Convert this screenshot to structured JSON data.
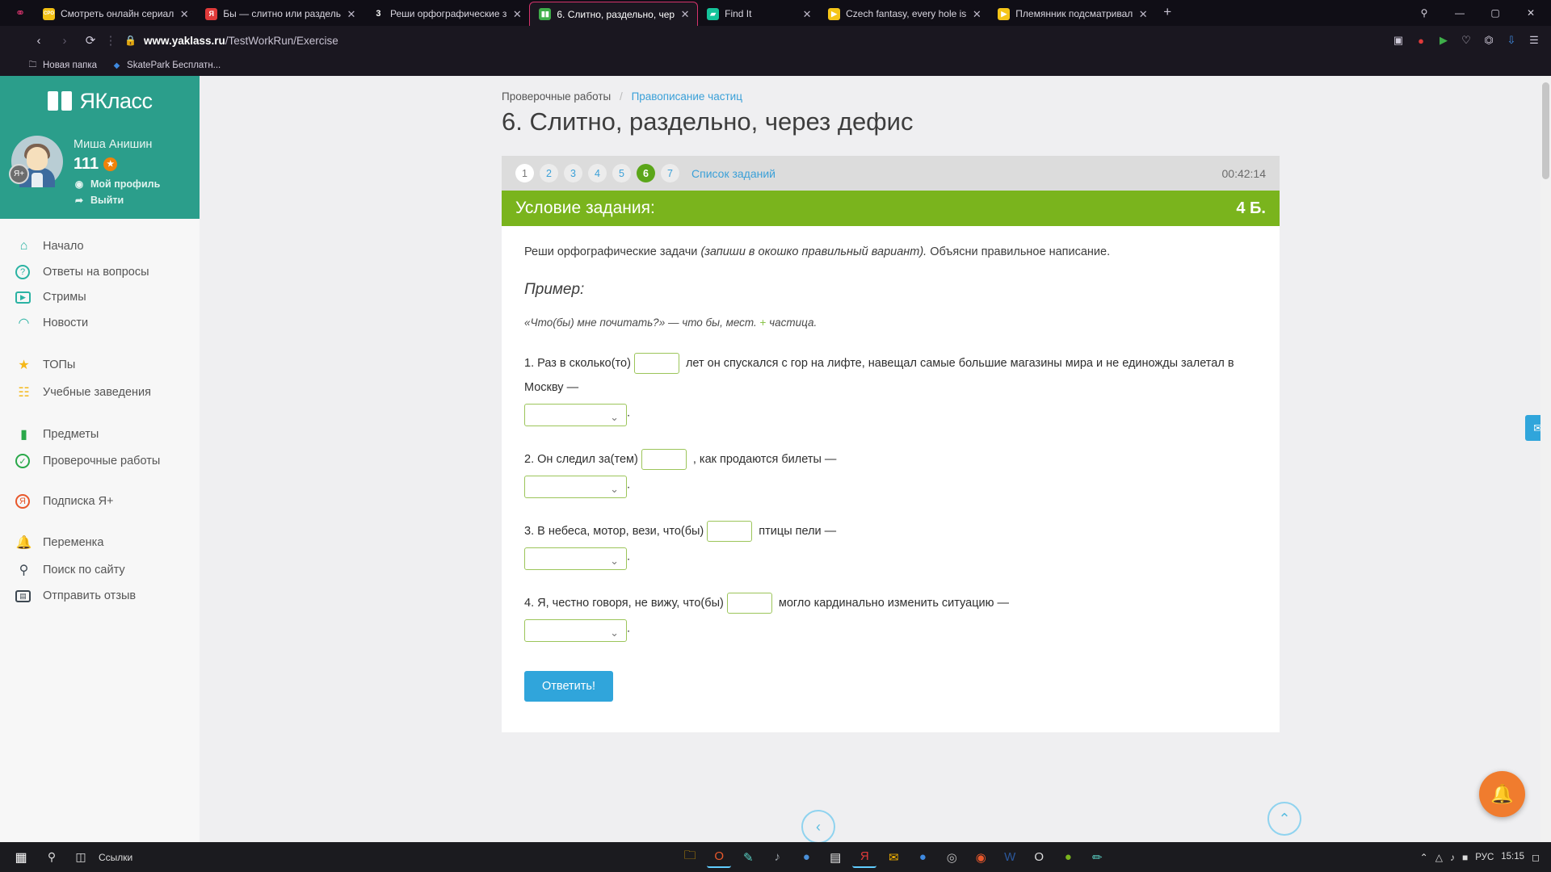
{
  "browser": {
    "tabs": [
      {
        "title": "Смотреть онлайн сериал",
        "favicon": "cro-icon",
        "favicon_color": "#f2c014",
        "favicon_text": "CPO",
        "active": false
      },
      {
        "title": "Бы — слитно или раздель",
        "favicon": "yandex-icon",
        "favicon_color": "#e03a3a",
        "favicon_text": "Я",
        "active": false
      },
      {
        "title": "Реши орфографические з",
        "favicon": "three-icon",
        "favicon_color": "transparent",
        "favicon_text": "3",
        "active": false
      },
      {
        "title": "6. Слитно, раздельно, чер",
        "favicon": "yaklass-icon",
        "favicon_color": "#3fae4a",
        "favicon_text": "▮▮",
        "active": true
      },
      {
        "title": "Find It",
        "favicon": "folder-icon",
        "favicon_color": "#15c39a",
        "favicon_text": "▰",
        "active": false
      },
      {
        "title": "Czech fantasy, every hole is",
        "favicon": "play-icon",
        "favicon_color": "#f5c518",
        "favicon_text": "▶",
        "active": false
      },
      {
        "title": "Племянник подсматривал",
        "favicon": "play-icon",
        "favicon_color": "#f5c518",
        "favicon_text": "▶",
        "active": false
      }
    ],
    "new_tab_label": "+",
    "close_label": "✕",
    "window_controls": {
      "minimize": "—",
      "maximize": "▢",
      "close": "✕"
    },
    "nav": {
      "back": "‹",
      "forward": "›",
      "reload": "⟳",
      "menu_dots": "⋮",
      "lock": "🔒",
      "url_domain": "www.yaklass.ru",
      "url_path": "/TestWorkRun/Exercise"
    },
    "toolbar_icons": [
      "camera-icon",
      "shield-icon",
      "play-icon",
      "heart-icon",
      "puzzle-icon",
      "download-icon",
      "hamburger-icon"
    ],
    "bookmarks": [
      {
        "label": "Новая папка",
        "icon": "folder-icon"
      },
      {
        "label": "SkatePark Бесплатн...",
        "icon": "diamond-icon"
      }
    ]
  },
  "sidebar": {
    "logo_text": "ЯКласс",
    "profile": {
      "name": "Миша Анишин",
      "points": "111",
      "badge_label": "Я+",
      "links": [
        {
          "label": "Мой профиль",
          "icon": "user-circle-icon"
        },
        {
          "label": "Выйти",
          "icon": "logout-icon"
        }
      ]
    },
    "menu_groups": [
      [
        {
          "label": "Начало",
          "icon": "home-icon",
          "color": "#2bb3a3"
        },
        {
          "label": "Ответы на вопросы",
          "icon": "question-circle-icon",
          "color": "#2bb3a3"
        },
        {
          "label": "Стримы",
          "icon": "video-icon",
          "color": "#2bb3a3"
        },
        {
          "label": "Новости",
          "icon": "megaphone-icon",
          "color": "#2bb3a3"
        }
      ],
      [
        {
          "label": "ТОПы",
          "icon": "star-icon",
          "color": "#f5b819"
        },
        {
          "label": "Учебные заведения",
          "icon": "bank-icon",
          "color": "#f5b819"
        }
      ],
      [
        {
          "label": "Предметы",
          "icon": "books-icon",
          "color": "#2aa84a"
        },
        {
          "label": "Проверочные работы",
          "icon": "check-circle-icon",
          "color": "#2aa84a"
        }
      ],
      [
        {
          "label": "Подписка Я+",
          "icon": "subscription-icon",
          "color": "#e8582c"
        }
      ],
      [
        {
          "label": "Переменка",
          "icon": "bell-icon",
          "color": "#3d4852"
        },
        {
          "label": "Поиск по сайту",
          "icon": "search-icon",
          "color": "#3d4852"
        },
        {
          "label": "Отправить отзыв",
          "icon": "feedback-icon",
          "color": "#3d4852"
        }
      ]
    ]
  },
  "page": {
    "breadcrumb": {
      "root": "Проверочные работы",
      "separator": "/",
      "current": "Правописание частиц"
    },
    "title": "6. Слитно, раздельно, через дефис",
    "pager": {
      "numbers": [
        "1",
        "2",
        "3",
        "4",
        "5",
        "6",
        "7"
      ],
      "current": "6",
      "list_link": "Список заданий",
      "timer": "00:42:14"
    },
    "task_header": {
      "title": "Условие задания:",
      "points": "4 Б."
    },
    "instruction_plain_1": "Реши орфографические задачи ",
    "instruction_italic": "(запиши в окошко правильный вариант).",
    "instruction_plain_2": " Объясни правильное написание.",
    "example_label": "Пример:",
    "example_text_1": "«Что(бы) мне почитать?» — что бы, мест. ",
    "example_plus": "+",
    "example_text_2": " частица.",
    "questions": [
      {
        "number": "1.",
        "text_before": "Раз в сколько(то)",
        "input_value": "",
        "input_width": "56",
        "text_after": "лет он спускался с гор на лифте, навещал самые большие магазины мира и не единожды залетал в Москву —",
        "select_value": "",
        "trailing": "."
      },
      {
        "number": "2.",
        "text_before": "Он следил за(тем)",
        "input_value": "",
        "input_width": "56",
        "text_after": ", как продаются билеты —",
        "select_value": "",
        "trailing": "."
      },
      {
        "number": "3.",
        "text_before": "В небеса, мотор, вези, что(бы)",
        "input_value": "",
        "input_width": "56",
        "text_after": "птицы пели —",
        "select_value": "",
        "trailing": "."
      },
      {
        "number": "4.",
        "text_before": "Я, честно говоря, не вижу, что(бы)",
        "input_value": "",
        "input_width": "56",
        "text_after": "могло кардинально изменить ситуацию —",
        "select_value": "",
        "trailing": "."
      }
    ],
    "submit_label": "Ответить!",
    "mail_tab_icon": "envelope-icon",
    "help_icon": "bell-icon",
    "bottom_nav": {
      "prev": "‹",
      "up": "⌃",
      "next": "›"
    }
  },
  "taskbar": {
    "start_icon": "windows-icon",
    "search_icon": "search-icon",
    "task_view_icon": "task-view-icon",
    "links_label": "Ссылки",
    "apps": [
      {
        "icon": "folder-icon",
        "color": "#f5b301",
        "active": false
      },
      {
        "icon": "browser-icon",
        "color": "#e8582c",
        "active": true
      },
      {
        "icon": "pen-icon",
        "color": "#5ad1c4",
        "active": false
      },
      {
        "icon": "music-icon",
        "color": "#9aa0a6",
        "active": false
      },
      {
        "icon": "globe-icon",
        "color": "#4a90d9",
        "active": false
      },
      {
        "icon": "note-icon",
        "color": "#e8e8e8",
        "active": false
      },
      {
        "icon": "yandex-icon",
        "color": "#e03a3a",
        "active": true
      },
      {
        "icon": "mail-icon",
        "color": "#f5b301",
        "active": false
      },
      {
        "icon": "chat-icon",
        "color": "#3f8ae0",
        "active": false
      },
      {
        "icon": "camera-icon",
        "color": "#bbbbbb",
        "active": false
      },
      {
        "icon": "disc-icon",
        "color": "#e8582c",
        "active": false
      },
      {
        "icon": "word-icon",
        "color": "#2b579a",
        "active": false
      },
      {
        "icon": "opera-icon",
        "color": "#dddddd",
        "active": false
      },
      {
        "icon": "browser2-icon",
        "color": "#7ab41d",
        "active": false
      },
      {
        "icon": "brush-icon",
        "color": "#5ad1c4",
        "active": false
      }
    ],
    "tray": {
      "chevron": "⌃",
      "icons": [
        "network-icon",
        "sound-icon",
        "battery-icon"
      ],
      "language": "РУС",
      "time": "15:15",
      "date": ""
    }
  }
}
